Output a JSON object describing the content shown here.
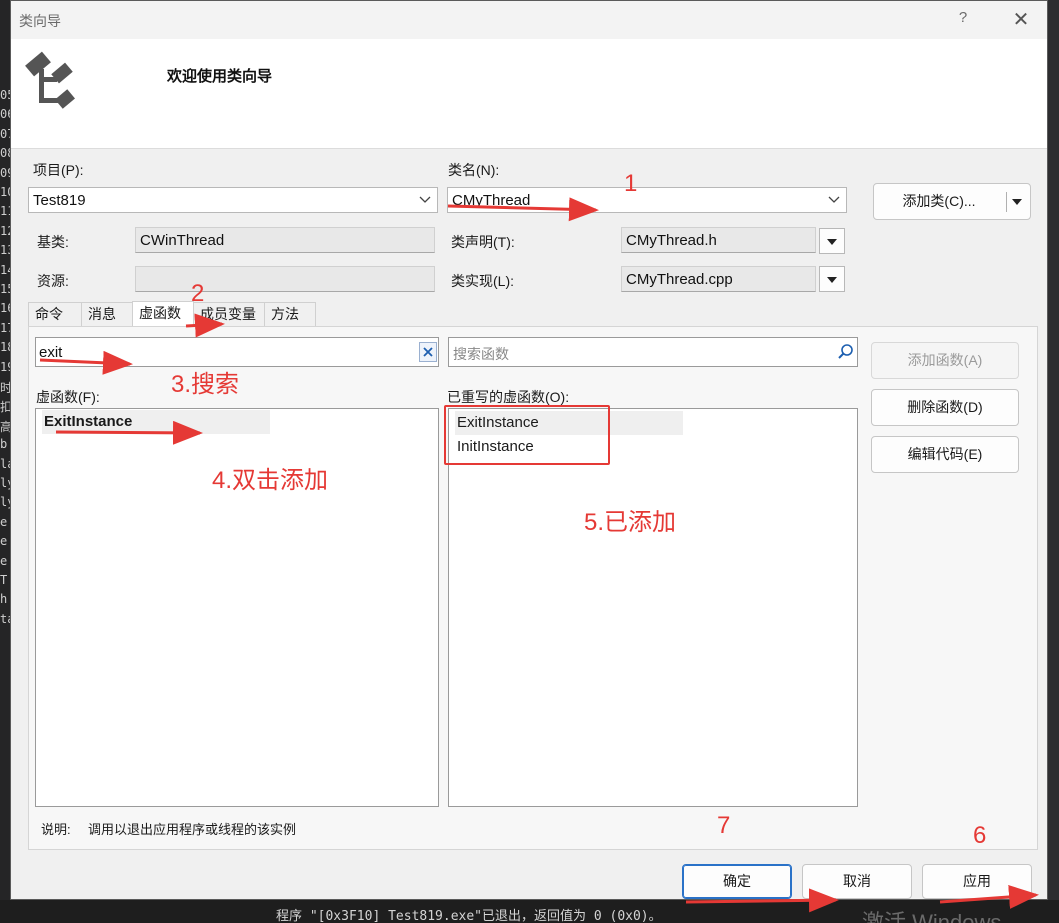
{
  "ide": {
    "left_gutter": [
      "05",
      "06",
      "07",
      "08",
      "09",
      "10",
      "11",
      "12",
      "13",
      "14",
      "15",
      "16",
      "17",
      "18",
      "19",
      "时",
      "扣",
      "高",
      "b",
      "la",
      "ly",
      "ly",
      "e",
      "e",
      "e",
      "T",
      "h",
      "ta"
    ],
    "output_line": "程序 \"[0x3F10] Test819.exe\"已退出，返回值为 0 (0x0)。",
    "watermark": "激活 Windows"
  },
  "dialog": {
    "title": "类向导",
    "help": "?",
    "close": "✕",
    "welcome": "欢迎使用类向导"
  },
  "form": {
    "project_label": "项目(P):",
    "project_value": "Test819",
    "classname_label": "类名(N):",
    "classname_value": "CMyThread",
    "add_class_button": "添加类(C)...",
    "base_label": "基类:",
    "base_value": "CWinThread",
    "resource_label": "资源:",
    "resource_value": "",
    "header_label": "类声明(T):",
    "header_value": "CMyThread.h",
    "impl_label": "类实现(L):",
    "impl_value": "CMyThread.cpp"
  },
  "tabs": [
    "命令",
    "消息",
    "虚函数",
    "成员变量",
    "方法"
  ],
  "virtual": {
    "search_value": "exit",
    "search_placeholder": "搜索函数",
    "list_label": "虚函数(F):",
    "list_items": [
      "ExitInstance"
    ],
    "overridden_label": "已重写的虚函数(O):",
    "overridden_items": [
      "ExitInstance",
      "InitInstance"
    ],
    "add_function_button": "添加函数(A)",
    "delete_function_button": "删除函数(D)",
    "edit_code_button": "编辑代码(E)",
    "description_label": "说明:",
    "description_text": "调用以退出应用程序或线程的该实例"
  },
  "footer": {
    "ok": "确定",
    "cancel": "取消",
    "apply": "应用"
  },
  "annotations": {
    "n1": "1",
    "n2": "2",
    "n3": "3.搜索",
    "n4": "4.双击添加",
    "n5": "5.已添加",
    "n6": "6",
    "n7": "7",
    "color": "#e53935"
  }
}
